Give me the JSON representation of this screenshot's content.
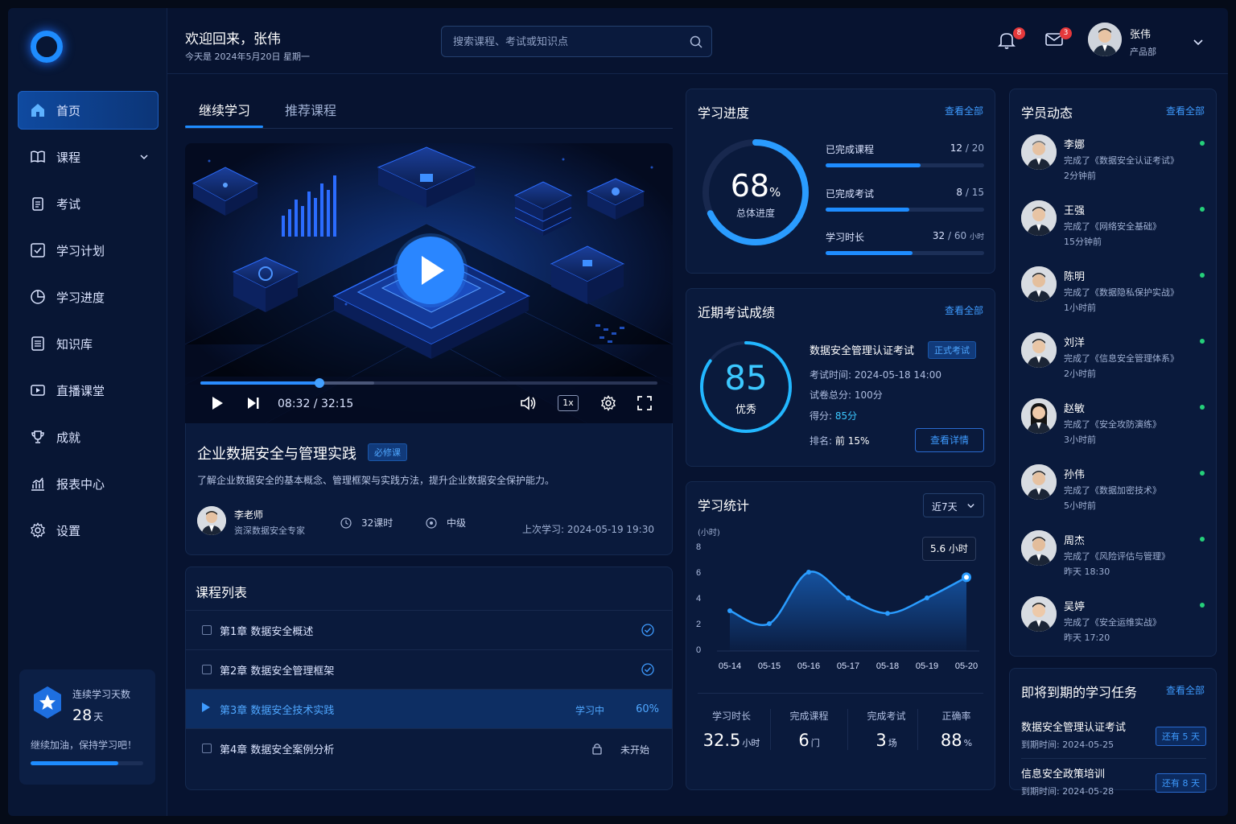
{
  "header": {
    "welcome": "欢迎回来，张伟",
    "date": "今天是 2024年5月20日 星期一",
    "search_placeholder": "搜索课程、考试或知识点",
    "notifications_count": "8",
    "messages_count": "3",
    "user_name": "张伟",
    "user_dept": "产品部"
  },
  "sidebar": {
    "items": [
      {
        "label": "首页",
        "icon": "home-icon"
      },
      {
        "label": "课程",
        "icon": "book-icon"
      },
      {
        "label": "考试",
        "icon": "clipboard-icon"
      },
      {
        "label": "学习计划",
        "icon": "check-square-icon"
      },
      {
        "label": "学习进度",
        "icon": "pie-chart-icon"
      },
      {
        "label": "知识库",
        "icon": "list-icon"
      },
      {
        "label": "直播课堂",
        "icon": "video-icon"
      },
      {
        "label": "成就",
        "icon": "trophy-icon"
      },
      {
        "label": "报表中心",
        "icon": "bar-chart-icon"
      },
      {
        "label": "设置",
        "icon": "gear-icon"
      }
    ],
    "streak": {
      "label": "连续学习天数",
      "days": "28",
      "unit": "天",
      "message": "继续加油，保持学习吧！",
      "progress": 0.78
    }
  },
  "tabs": [
    "继续学习",
    "推荐课程"
  ],
  "player": {
    "current": "08:32",
    "total": "32:15",
    "speed": "1x",
    "progress": 0.26
  },
  "course": {
    "title": "企业数据安全与管理实践",
    "tag": "必修课",
    "desc": "了解企业数据安全的基本概念、管理框架与实践方法，提升企业数据安全保护能力。",
    "teacher": "李老师",
    "teacher_role": "资深数据安全专家",
    "hours": "32课时",
    "level": "中级",
    "last": "上次学习: 2024-05-19 19:30"
  },
  "chapters": {
    "title": "课程列表",
    "items": [
      {
        "name": "第1章  数据安全概述",
        "status": "done"
      },
      {
        "name": "第2章  数据安全管理框架",
        "status": "done"
      },
      {
        "name": "第3章  数据安全技术实践",
        "status": "学习中",
        "pct": "60%"
      },
      {
        "name": "第4章  数据安全案例分析",
        "status": "未开始"
      }
    ]
  },
  "progress": {
    "title": "学习进度",
    "view_all": "查看全部",
    "percent": "68",
    "percent_value": 0.68,
    "unit": "%",
    "label": "总体进度",
    "rows": [
      {
        "label": "已完成课程",
        "value": "12",
        "total": "/ 20",
        "ratio": 0.6
      },
      {
        "label": "已完成考试",
        "value": "8",
        "total": "/ 15",
        "ratio": 0.53
      },
      {
        "label": "学习时长",
        "value": "32",
        "total": "/ 60",
        "unit": "小时",
        "ratio": 0.55
      }
    ]
  },
  "exam": {
    "title": "近期考试成绩",
    "view_all": "查看全部",
    "score": "85",
    "score_value": 0.85,
    "grade": "优秀",
    "name": "数据安全管理认证考试",
    "tag": "正式考试",
    "time": "考试时间:  2024-05-18 14:00",
    "total": "试卷总分:  100分",
    "got_label": "得分:",
    "got": "85分",
    "rank_label": "排名:",
    "rank": "前 15%",
    "button": "查看详情"
  },
  "stats": {
    "title": "学习统计",
    "range": "近7天",
    "unit": "(小时)",
    "tooltip": "5.6 小时",
    "kpis": [
      {
        "label": "学习时长",
        "value": "32.5",
        "unit": "小时"
      },
      {
        "label": "完成课程",
        "value": "6",
        "unit": "门"
      },
      {
        "label": "完成考试",
        "value": "3",
        "unit": "场"
      },
      {
        "label": "正确率",
        "value": "88",
        "unit": "%"
      }
    ]
  },
  "chart_data": {
    "type": "area",
    "x": [
      "05-14",
      "05-15",
      "05-16",
      "05-17",
      "05-18",
      "05-19",
      "05-20"
    ],
    "values": [
      3.0,
      2.0,
      6.0,
      4.0,
      2.8,
      4.0,
      5.6
    ],
    "ylim": [
      0,
      8
    ],
    "yticks": [
      0,
      2,
      4,
      6,
      8
    ],
    "ylabel": "(小时)",
    "grid": false
  },
  "activity": {
    "title": "学员动态",
    "view_all": "查看全部",
    "items": [
      {
        "name": "李娜",
        "desc": "完成了《数据安全认证考试》",
        "time": "2分钟前"
      },
      {
        "name": "王强",
        "desc": "完成了《网络安全基础》",
        "time": "15分钟前"
      },
      {
        "name": "陈明",
        "desc": "完成了《数据隐私保护实战》",
        "time": "1小时前"
      },
      {
        "name": "刘洋",
        "desc": "完成了《信息安全管理体系》",
        "time": "2小时前"
      },
      {
        "name": "赵敏",
        "desc": "完成了《安全攻防演练》",
        "time": "3小时前"
      },
      {
        "name": "孙伟",
        "desc": "完成了《数据加密技术》",
        "time": "5小时前"
      },
      {
        "name": "周杰",
        "desc": "完成了《风险评估与管理》",
        "time": "昨天 18:30"
      },
      {
        "name": "吴婷",
        "desc": "完成了《安全运维实战》",
        "time": "昨天 17:20"
      }
    ]
  },
  "tasks": {
    "title": "即将到期的学习任务",
    "view_all": "查看全部",
    "items": [
      {
        "name": "数据安全管理认证考试",
        "due": "到期时间:  2024-05-25",
        "left": "还有 5 天"
      },
      {
        "name": "信息安全政策培训",
        "due": "到期时间:  2024-05-28",
        "left": "还有 8 天"
      }
    ]
  }
}
